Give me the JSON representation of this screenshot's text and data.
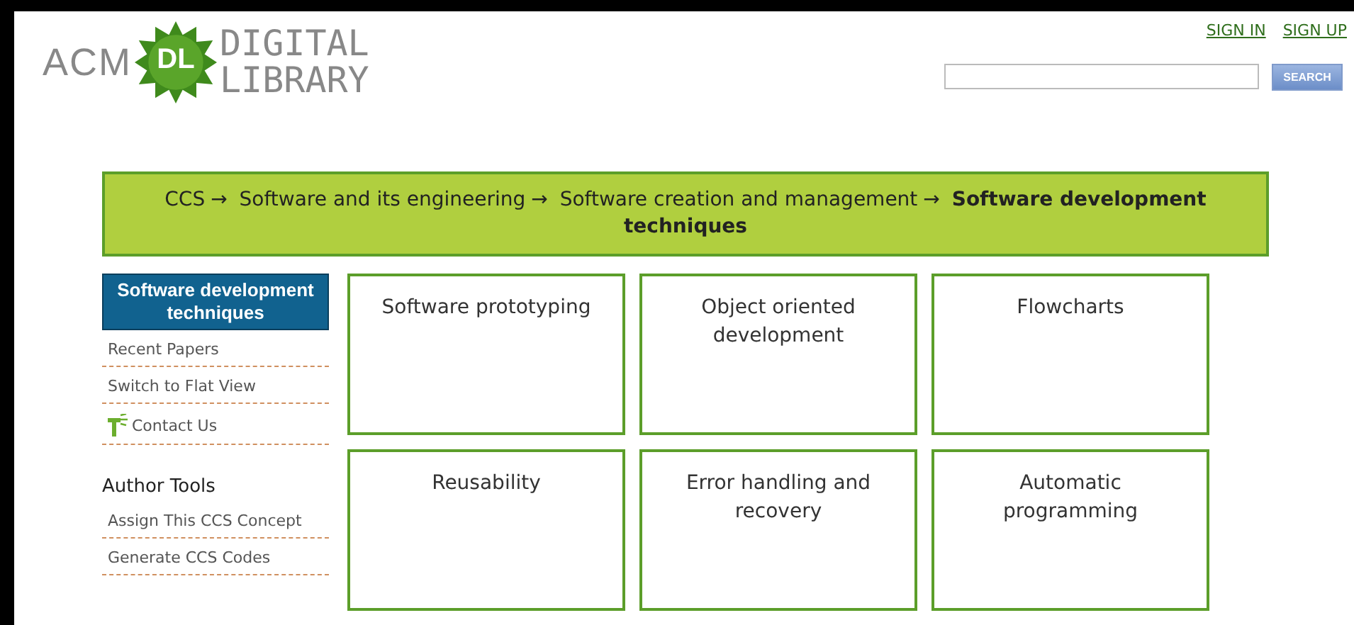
{
  "logo": {
    "left": "ACM",
    "badge": "DL",
    "lines": [
      "DIGITAL",
      "LIBRARY"
    ]
  },
  "account_links": [
    "SIGN IN",
    "SIGN UP"
  ],
  "search": {
    "button": "SEARCH"
  },
  "breadcrumb": {
    "separator": "→",
    "items": [
      {
        "label": "CCS",
        "current": false
      },
      {
        "label": "Software and its engineering",
        "current": false
      },
      {
        "label": "Software creation and management",
        "current": false
      },
      {
        "label": "Software development techniques",
        "current": true
      }
    ]
  },
  "sidebar": {
    "title": "Software development techniques",
    "items": [
      {
        "label": "Recent Papers",
        "kind": "link"
      },
      {
        "label": "Switch to Flat View",
        "kind": "link"
      },
      {
        "label": "Contact Us",
        "kind": "contact"
      }
    ],
    "section_title": "Author Tools",
    "tools": [
      "Assign This CCS Concept",
      "Generate CCS Codes"
    ]
  },
  "concepts": [
    "Software prototyping",
    "Object oriented development",
    "Flowcharts",
    "Reusability",
    "Error handling and recovery",
    "Automatic programming"
  ]
}
